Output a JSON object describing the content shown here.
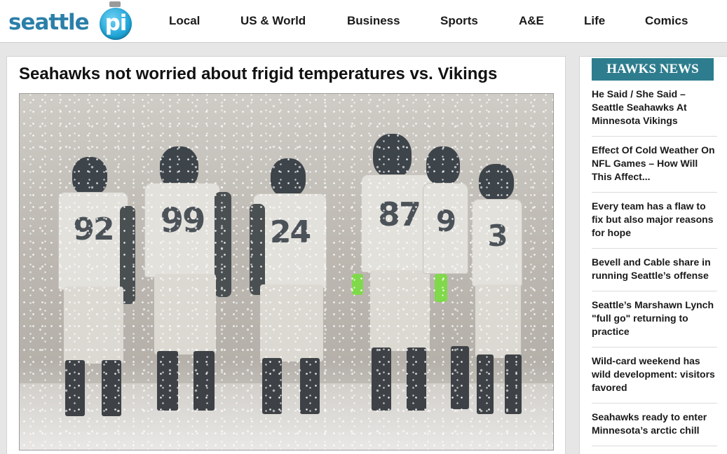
{
  "site": {
    "logo_text": "seattle",
    "logo_badge": "pi"
  },
  "nav": {
    "items": [
      {
        "label": "Local"
      },
      {
        "label": "US & World"
      },
      {
        "label": "Business"
      },
      {
        "label": "Sports"
      },
      {
        "label": "A&E"
      },
      {
        "label": "Life"
      },
      {
        "label": "Comics"
      }
    ]
  },
  "article": {
    "headline": "Seahawks not worried about frigid temperatures vs. Vikings",
    "photo": {
      "jersey_numbers": [
        "92",
        "99",
        "24",
        "87",
        "9",
        "3"
      ]
    }
  },
  "sidebar": {
    "title": "HAWKS NEWS",
    "items": [
      {
        "label": "He Said / She Said – Seattle Seahawks At Minnesota Vikings"
      },
      {
        "label": "Effect Of Cold Weather On NFL Games – How Will This Affect..."
      },
      {
        "label": "Every team has a flaw to fix but also major reasons for hope"
      },
      {
        "label": "Bevell and Cable share in running Seattle’s offense"
      },
      {
        "label": "Seattle’s Marshawn Lynch \"full go\" returning to practice"
      },
      {
        "label": "Wild-card weekend has wild development: visitors favored"
      },
      {
        "label": "Seahawks ready to enter Minnesota’s arctic chill"
      }
    ]
  },
  "colors": {
    "brand": "#2b7fa9",
    "sidebar_accent": "#2e7d8e",
    "glove": "#7fd94a"
  }
}
